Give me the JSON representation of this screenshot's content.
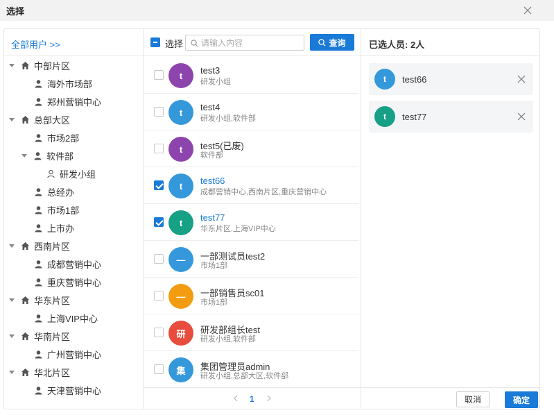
{
  "dialog": {
    "title": "选择"
  },
  "tree": {
    "all_users_link": "全部用户 >>",
    "nodes": [
      {
        "label": "中部片区",
        "type": "region",
        "expanded": true
      },
      {
        "label": "海外市场部",
        "type": "dept"
      },
      {
        "label": "郑州营销中心",
        "type": "dept"
      },
      {
        "label": "总部大区",
        "type": "region",
        "expanded": true
      },
      {
        "label": "市场2部",
        "type": "dept"
      },
      {
        "label": "软件部",
        "type": "dept",
        "expanded": true
      },
      {
        "label": "研发小组",
        "type": "group"
      },
      {
        "label": "总经办",
        "type": "dept"
      },
      {
        "label": "市场1部",
        "type": "dept"
      },
      {
        "label": "上市办",
        "type": "dept"
      },
      {
        "label": "西南片区",
        "type": "region",
        "expanded": true
      },
      {
        "label": "成都营销中心",
        "type": "dept"
      },
      {
        "label": "重庆营销中心",
        "type": "dept"
      },
      {
        "label": "华东片区",
        "type": "region",
        "expanded": true
      },
      {
        "label": "上海VIP中心",
        "type": "dept"
      },
      {
        "label": "华南片区",
        "type": "region",
        "expanded": true
      },
      {
        "label": "广州营销中心",
        "type": "dept"
      },
      {
        "label": "华北片区",
        "type": "region",
        "expanded": true
      },
      {
        "label": "天津营销中心",
        "type": "dept"
      }
    ]
  },
  "user_list": {
    "select_all_label": "选择",
    "search_placeholder": "请输入内容",
    "query_button": "查询",
    "users": [
      {
        "avatar_text": "t",
        "avatar_color": "#8e44ad",
        "name": "test3",
        "dept": "研发小组",
        "checked": false
      },
      {
        "avatar_text": "t",
        "avatar_color": "#3498db",
        "name": "test4",
        "dept": "研发小组,软件部",
        "checked": false
      },
      {
        "avatar_text": "t",
        "avatar_color": "#8e44ad",
        "name": "test5(已废)",
        "dept": "软件部",
        "checked": false
      },
      {
        "avatar_text": "t",
        "avatar_color": "#3498db",
        "name": "test66",
        "dept": "成都营销中心,西南片区,重庆营销中心",
        "checked": true
      },
      {
        "avatar_text": "t",
        "avatar_color": "#16a085",
        "name": "test77",
        "dept": "华东片区,上海VIP中心",
        "checked": true
      },
      {
        "avatar_text": "—",
        "avatar_color": "#3498db",
        "name": "一部测试员test2",
        "dept": "市场1部",
        "checked": false
      },
      {
        "avatar_text": "—",
        "avatar_color": "#f39c12",
        "name": "一部销售员sc01",
        "dept": "市场1部",
        "checked": false
      },
      {
        "avatar_text": "研",
        "avatar_color": "#e74c3c",
        "name": "研发部组长test",
        "dept": "研发小组,软件部",
        "checked": false
      },
      {
        "avatar_text": "集",
        "avatar_color": "#3498db",
        "name": "集团管理员admin",
        "dept": "研发小组,总部大区,软件部",
        "checked": false
      }
    ],
    "pagination": {
      "current_page": "1"
    }
  },
  "selected_panel": {
    "header": "已选人员: 2人",
    "items": [
      {
        "avatar_text": "t",
        "avatar_color": "#3498db",
        "name": "test66"
      },
      {
        "avatar_text": "t",
        "avatar_color": "#16a085",
        "name": "test77"
      }
    ],
    "cancel_button": "取消",
    "ok_button": "确定"
  },
  "colors": {
    "accent": "#1a7ad8",
    "selected_name": "#1a7ad8"
  }
}
